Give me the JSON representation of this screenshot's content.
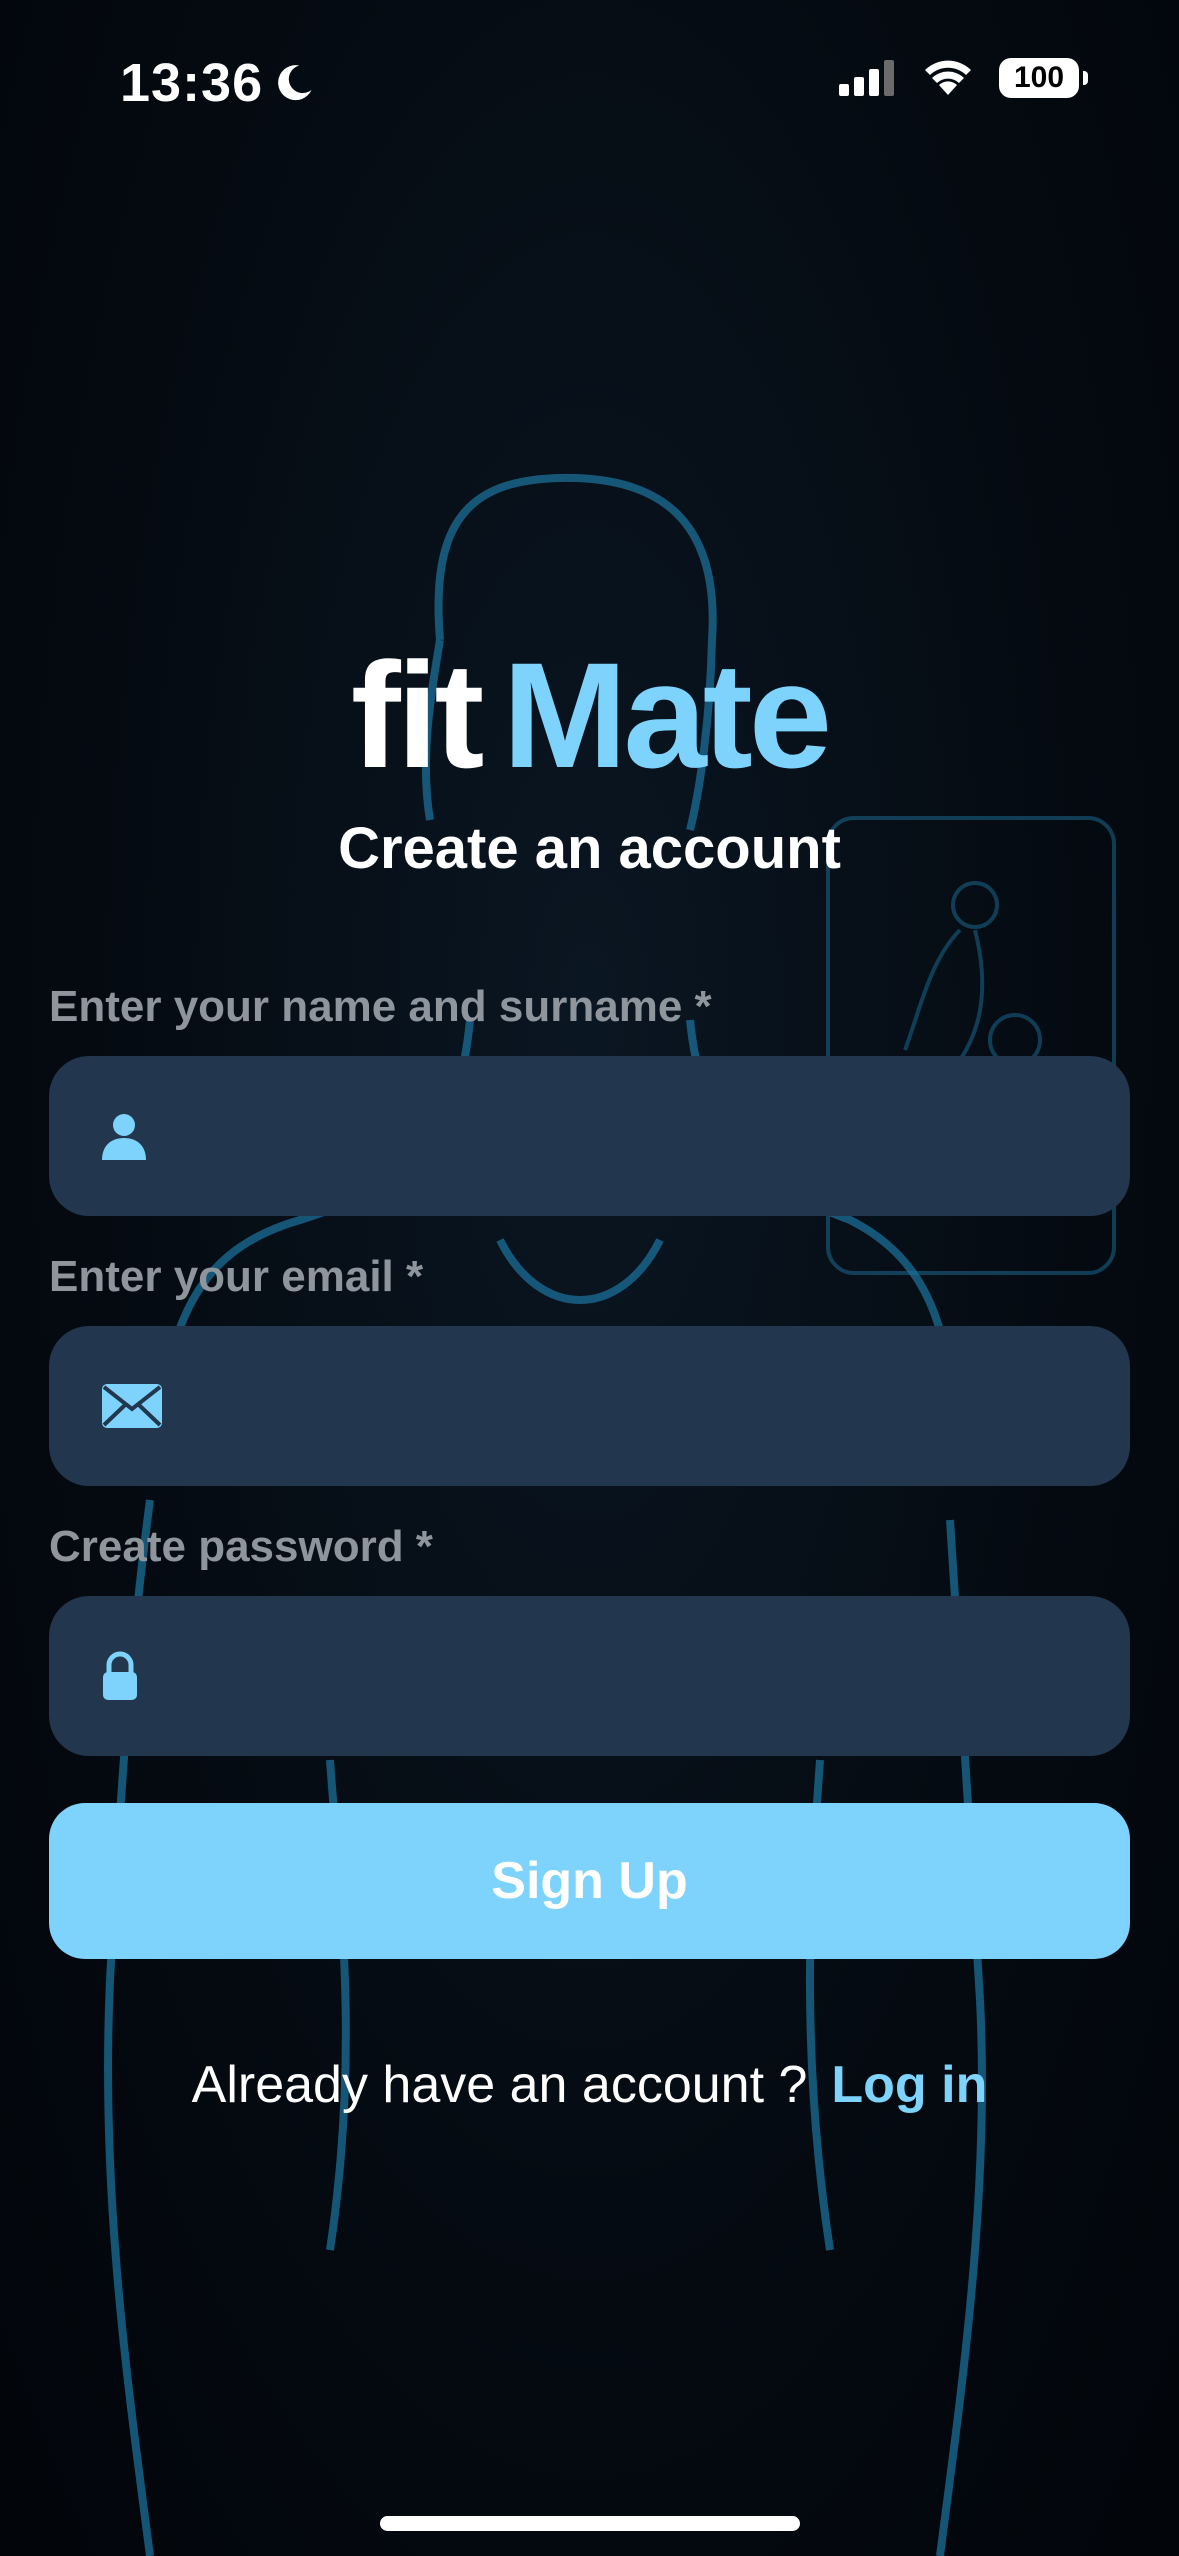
{
  "status_bar": {
    "time": "13:36",
    "battery": "100",
    "icons": [
      "moon-icon",
      "cellular-signal-icon",
      "wifi-icon",
      "battery-icon"
    ]
  },
  "brand": {
    "part1": "fit",
    "part2": "Mate",
    "accent_color": "#7dd3fc"
  },
  "subtitle": "Create an account",
  "form": {
    "name_label": "Enter your name and surname *",
    "name_value": "",
    "name_icon": "person-icon",
    "email_label": "Enter your email *",
    "email_value": "",
    "email_icon": "envelope-icon",
    "password_label": "Create password *",
    "password_value": "",
    "password_icon": "lock-icon",
    "field_color": "#22364d"
  },
  "signup_label": "Sign Up",
  "login_prompt": "Already have an account ?",
  "login_link": "Log in"
}
